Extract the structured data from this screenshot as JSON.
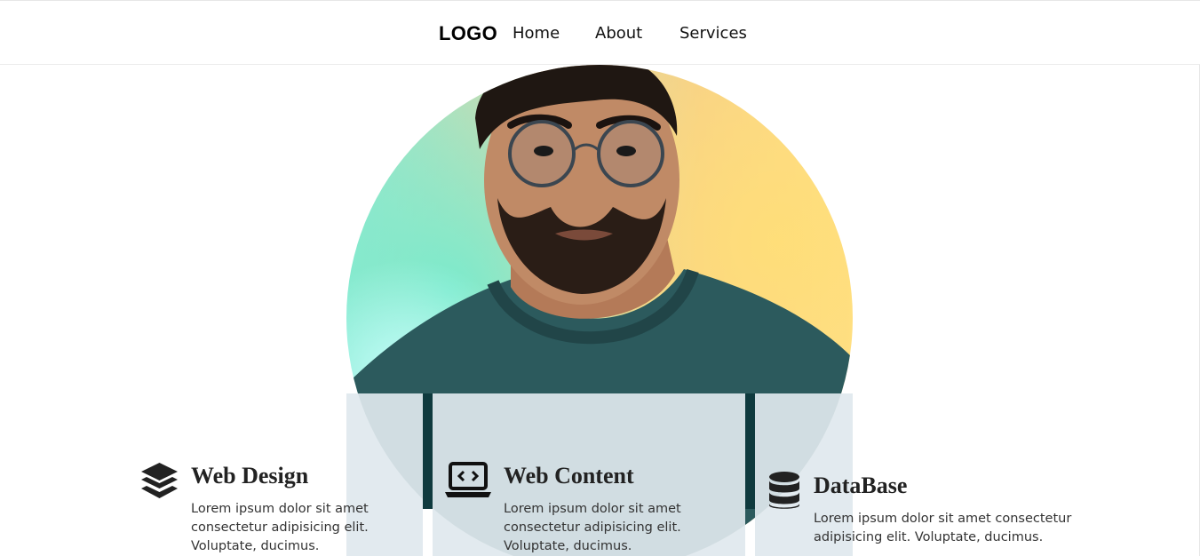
{
  "nav": {
    "logo": "LOGO",
    "links": [
      "Home",
      "About",
      "Services"
    ]
  },
  "hero": {
    "image": "portrait-man-glasses"
  },
  "services": [
    {
      "icon": "layers-icon",
      "title": "Web Design",
      "text": "Lorem ipsum dolor sit amet consectetur adipisicing elit. Voluptate, ducimus."
    },
    {
      "icon": "laptop-code-icon",
      "title": "Web Content",
      "text": "Lorem ipsum dolor sit amet consectetur adipisicing elit. Voluptate, ducimus."
    },
    {
      "icon": "database-icon",
      "title": "DataBase",
      "text": "Lorem ipsum dolor sit amet consectetur adipisicing elit. Voluptate, ducimus."
    }
  ],
  "colors": {
    "text": "#222222",
    "shirt": "#2c5a5d",
    "panel": "#e0e8ee"
  }
}
